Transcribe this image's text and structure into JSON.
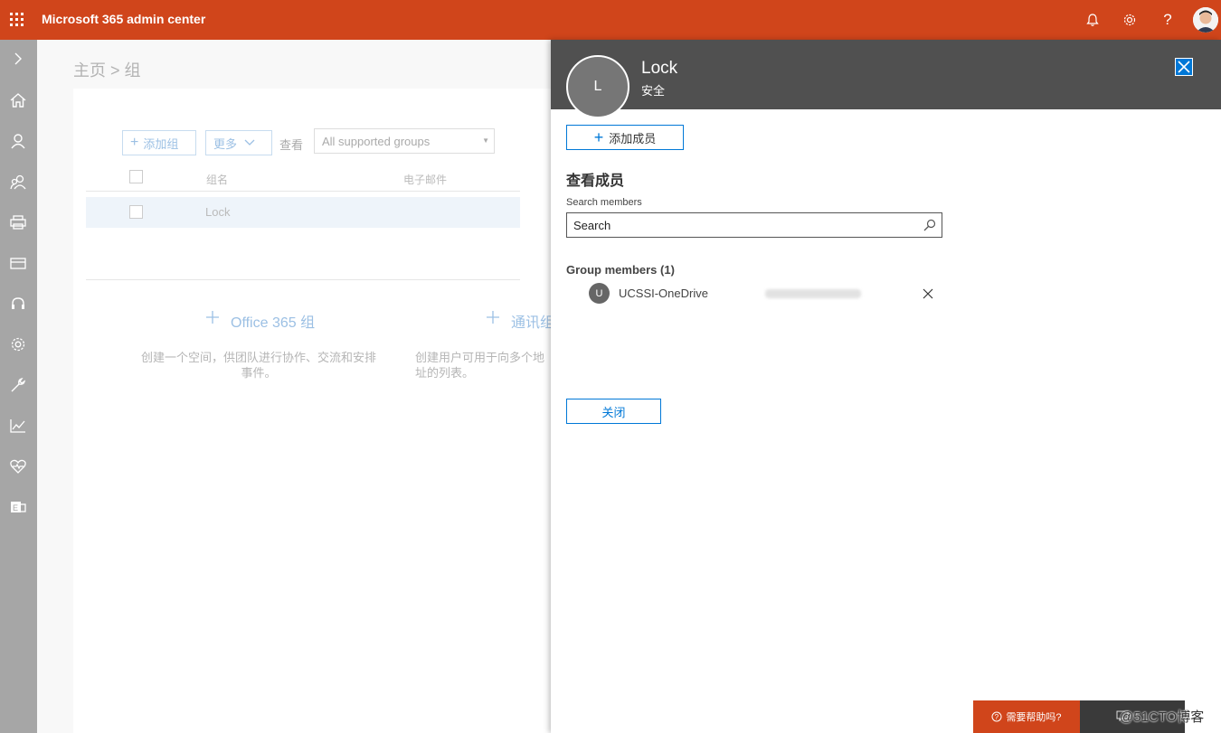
{
  "header": {
    "app_title": "Microsoft 365 admin center",
    "icons": [
      "waffle-icon",
      "bell-icon",
      "gear-icon",
      "help-icon",
      "user-avatar"
    ],
    "brand_color": "#d0451b"
  },
  "leftnav": {
    "items": [
      "expand-icon",
      "home-icon",
      "user-icon",
      "groups-icon",
      "resources-icon",
      "billing-icon",
      "support-icon",
      "settings-icon",
      "setup-icon",
      "reports-icon",
      "health-icon",
      "exchange-icon"
    ]
  },
  "main": {
    "breadcrumb": "主页 > 组",
    "toolbar": {
      "add_group": "添加组",
      "more": "更多",
      "view_label": "查看",
      "view_select": "All supported groups"
    },
    "table": {
      "col_name": "组名",
      "col_email": "电子邮件",
      "rows": [
        {
          "name": "Lock"
        }
      ]
    },
    "create_options": [
      {
        "title": "Office 365 组",
        "desc": "创建一个空间，供团队进行协作、交流和安排事件。"
      },
      {
        "title": "通讯组",
        "desc": "创建用户可用于向多个地址的列表。"
      }
    ]
  },
  "panel": {
    "avatar_letter": "L",
    "title": "Lock",
    "subtitle": "安全",
    "add_member": "添加成员",
    "section_title": "查看成员",
    "search_label": "Search members",
    "search_value": "Search",
    "members_title": "Group members (1)",
    "members": [
      {
        "initial": "U",
        "name": "UCSSI-OneDrive"
      }
    ],
    "close_button": "关闭"
  },
  "footer": {
    "help": "需要帮助吗?",
    "watermark": "@51CTO博客"
  }
}
